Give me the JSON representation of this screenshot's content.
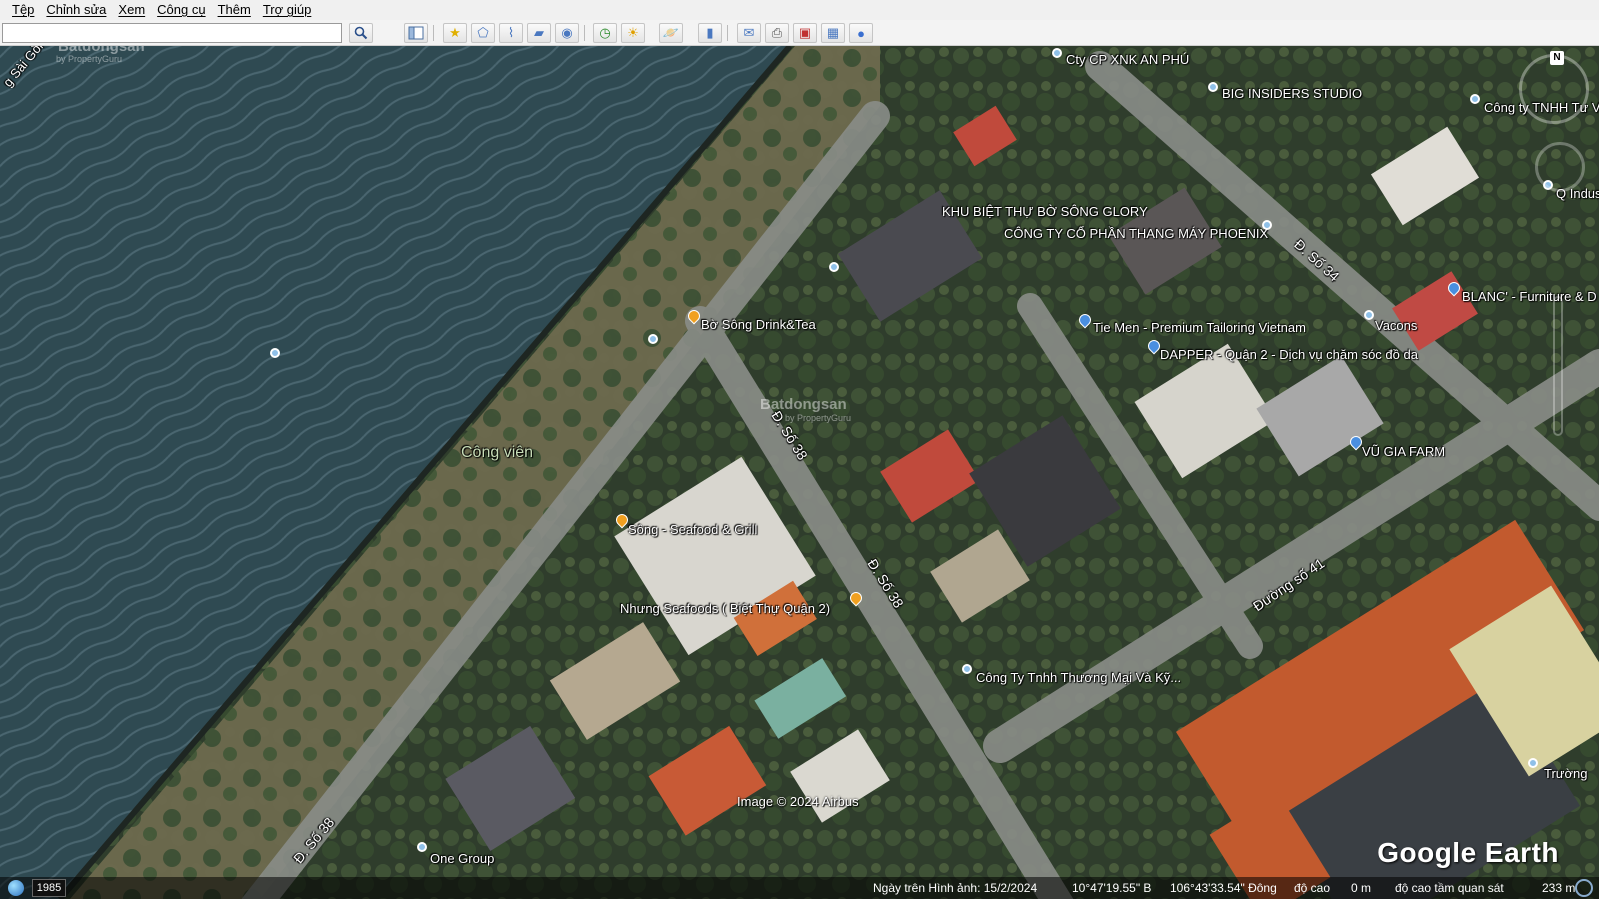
{
  "menu": [
    "Tệp",
    "Chỉnh sửa",
    "Xem",
    "Công cụ",
    "Thêm",
    "Trợ giúp"
  ],
  "search": {
    "value": "",
    "placeholder": ""
  },
  "toolbar_icons": [
    "search-icon",
    "sidebar-icon",
    "placemark-icon",
    "polygon-icon",
    "path-icon",
    "overlay-icon",
    "tour-icon",
    "historical-imagery-icon",
    "sunlight-icon",
    "planets-icon",
    "ruler-icon",
    "email-icon",
    "print-icon",
    "save-image-icon",
    "map-view-icon",
    "google-maps-icon"
  ],
  "watermark": {
    "text": "Batdongsan",
    "sub": "by PropertyGuru"
  },
  "labels": {
    "river_road": "g Sài Gòn",
    "park": "Công viên",
    "company_an_phu": "Cty CP XNK AN PHÚ",
    "big_insiders": "BIG INSIDERS STUDIO",
    "cong_ty_tnhh_tu_van": "Công ty TNHH Tư Vấ",
    "q_indus": "Q Indus",
    "khu_biet_thu": "KHU BIỆT THỰ BỜ SÔNG GLORY",
    "phoenix": "CÔNG TY CỔ PHẦN THANG MÁY PHOENIX",
    "bo_song_drink": "Bờ Sông Drink&Tea",
    "tie_men": "Tie Men - Premium Tailoring Vietnam",
    "vacons": "Vacons",
    "blanc": "BLANC' - Furniture & D",
    "dapper": "DAPPER - Quận 2 - Dịch vụ chăm sóc đồ da",
    "vu_gia_farm": "VŨ GIA FARM",
    "song_seafood": "Sông - Seafood & Grill",
    "nhung_seafoods": "Nhưng Seafoods ( Biệt Thự Quận 2)",
    "cong_ty_thuong_mai": "Công Ty Tnhh Thương Mại Và Kỹ...",
    "truong": "Trường",
    "one_group": "One Group",
    "image_credit": "Image © 2024 Airbus"
  },
  "roads": {
    "d_so_34": "Đ. Số 34",
    "d_so_38_a": "Đ. Số 38",
    "d_so_38_b": "Đ. Số 38",
    "d_so_38_c": "Đ. Số 38",
    "duong_so_41": "Đường số 41"
  },
  "brand": "Google Earth",
  "navigation": {
    "north": "N"
  },
  "status": {
    "year": "1985",
    "imagery_date": "Ngày trên Hình ảnh: 15/2/2024",
    "lat": "10°47'19.55\" B",
    "lon": "106°43'33.54\" Đông",
    "elev_label": "độ cao",
    "elev_value": "0 m",
    "eye_label": "độ cao tầm quan sát",
    "eye_value": "233 m"
  }
}
